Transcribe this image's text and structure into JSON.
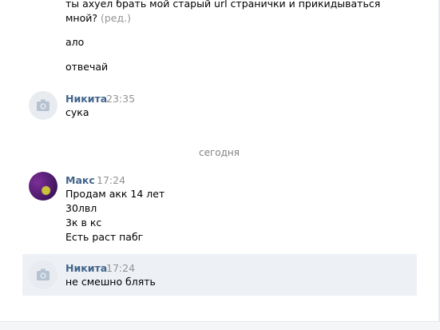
{
  "messages_top": {
    "line1": "ты ахуел брать мой старый url странички и прикидываться",
    "line2": "мной?",
    "edited_label": "(ред.)",
    "line3": "ало",
    "line4": "отвечай"
  },
  "msg_nikita_1": {
    "author": "Никита",
    "time": "23:35",
    "text": "сука"
  },
  "date_separator": "сегодня",
  "msg_maks": {
    "author": "Макс",
    "time": "17:24",
    "lines": [
      "Продам акк 14 лет",
      "30лвл",
      "3к в кс",
      "Есть раст пабг"
    ]
  },
  "msg_nikita_2": {
    "author": "Никита",
    "time": "17:24",
    "text": "не смешно блять"
  },
  "icons": {
    "default_avatar": "camera-icon"
  },
  "colors": {
    "author": "#42648b",
    "meta": "#939393",
    "highlight_bg": "#edf0f5"
  }
}
